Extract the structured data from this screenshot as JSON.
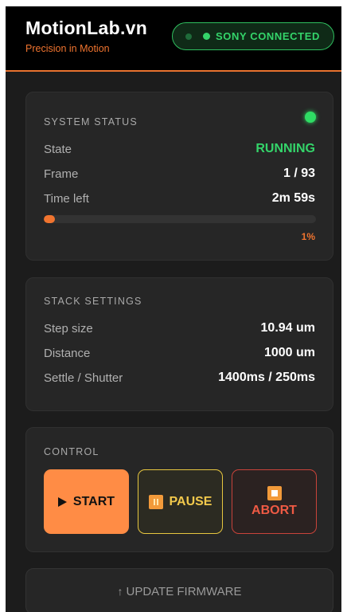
{
  "header": {
    "title": "MotionLab.vn",
    "subtitle": "Precision in Motion",
    "connection": "SONY CONNECTED"
  },
  "system_status": {
    "title": "SYSTEM STATUS",
    "rows": [
      {
        "label": "State",
        "value": "RUNNING"
      },
      {
        "label": "Frame",
        "value": "1 / 93"
      },
      {
        "label": "Time left",
        "value": "2m 59s"
      }
    ],
    "progress_percent": 1,
    "progress_label": "1%"
  },
  "stack_settings": {
    "title": "STACK SETTINGS",
    "rows": [
      {
        "label": "Step size",
        "value": "10.94 um"
      },
      {
        "label": "Distance",
        "value": "1000 um"
      },
      {
        "label": "Settle / Shutter",
        "value": "1400ms / 250ms"
      }
    ]
  },
  "control": {
    "title": "CONTROL",
    "start_label": "START",
    "pause_label": "PAUSE",
    "abort_label": "ABORT"
  },
  "firmware": {
    "label": "UPDATE FIRMWARE",
    "arrow": "↑"
  },
  "colors": {
    "accent": "#f0742f",
    "ok": "#34d46a",
    "warn": "#e6c640",
    "danger": "#ef5a44"
  },
  "icons": [
    "connection-dot-icon",
    "status-dot-icon",
    "play-icon",
    "pause-icon",
    "stop-icon",
    "upload-arrow-icon"
  ]
}
